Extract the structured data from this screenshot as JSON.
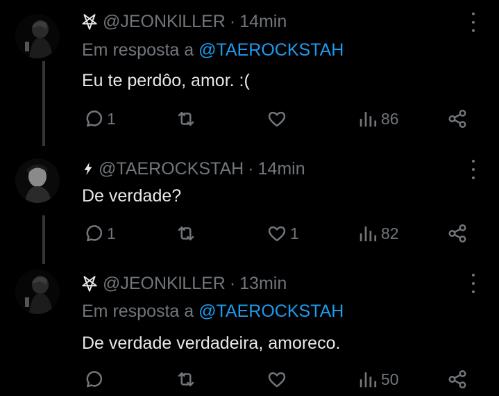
{
  "tweets": [
    {
      "handle": "@JEONKlLLER",
      "time": "14min",
      "reply_prefix": "Em resposta a",
      "reply_to": "@TAEROCKSTAH",
      "text": "Eu te perdôo, amor. :(",
      "replies": "1",
      "likes": "",
      "views": "86",
      "symbol": "pentagram-icon"
    },
    {
      "handle": "@TAEROCKSTAH",
      "time": "14min",
      "text": "De verdade?",
      "replies": "1",
      "likes": "1",
      "views": "82",
      "symbol": "lightning-icon"
    },
    {
      "handle": "@JEONKlLLER",
      "time": "13min",
      "reply_prefix": "Em resposta a",
      "reply_to": "@TAEROCKSTAH",
      "text": "De verdade verdadeira, amoreco.",
      "replies": "",
      "likes": "",
      "views": "50",
      "symbol": "pentagram-icon"
    }
  ],
  "colors": {
    "background": "#000000",
    "text": "#e7e9ea",
    "muted": "#71767b",
    "link": "#1d9bf0",
    "thread_line": "#333639"
  }
}
